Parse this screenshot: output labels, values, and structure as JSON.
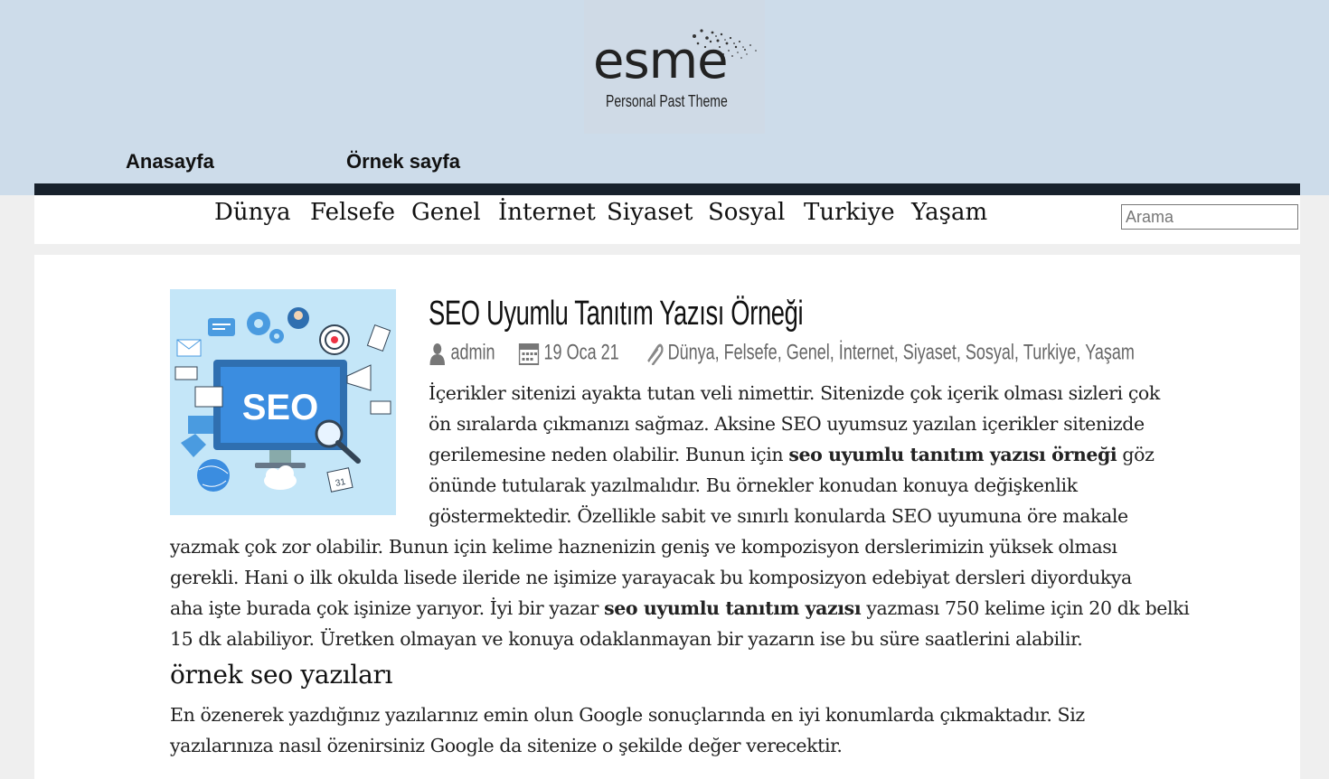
{
  "logo": {
    "name": "esme",
    "tagline": "Personal Past Theme"
  },
  "page_nav": [
    {
      "label": "Anasayfa"
    },
    {
      "label": "Örnek sayfa"
    }
  ],
  "categories": [
    "Dünya",
    "Felsefe",
    "Genel",
    "İnternet",
    "Siyaset",
    "Sosyal",
    "Turkiye",
    "Yaşam"
  ],
  "search": {
    "placeholder": "Arama"
  },
  "post": {
    "title": "SEO Uyumlu Tanıtım Yazısı Örneği",
    "thumbnail_label": "SEO",
    "meta": {
      "author": "admin",
      "date": "19 Oca 21",
      "categories": [
        "Dünya",
        "Felsefe",
        "Genel",
        "İnternet",
        "Siyaset",
        "Sosyal",
        "Turkiye",
        "Yaşam"
      ]
    },
    "intro_lines": [
      "İçerikler sitenizi ayakta tutan veli nimettir. Sitenizde çok içerik olması sizleri çok",
      "ön sıralarda çıkmanızı sağmaz. Aksine SEO uyumsuz yazılan içerikler sitenizde"
    ],
    "line3_before": "gerilemesine neden olabilir. Bunun için ",
    "line3_bold": "seo uyumlu tanıtım yazısı örneği",
    "line3_after": " göz",
    "line4": "önünde tutularak yazılmalıdır. Bu örnekler konudan konuya değişkenlik",
    "line5": "göstermektedir. Özellikle sabit ve sınırlı konularda SEO uyumuna öre makale",
    "line6": "yazmak çok zor olabilir. Bunun için kelime haznenizin geniş ve kompozisyon derslerimizin yüksek olması",
    "line7": "gerekli. Hani o ilk okulda lisede ileride ne işimize yarayacak bu komposizyon edebiyat dersleri diyordukya",
    "line8_before": "aha işte burada çok işinize yarıyor. İyi bir yazar ",
    "line8_bold": "seo uyumlu tanıtım yazısı",
    "line8_after": " yazması 750 kelime için 20 dk belki",
    "line9": "15 dk alabiliyor. Üretken olmayan ve konuya odaklanmayan bir yazarın ise bu süre  saatlerini alabilir.",
    "subheading": "örnek seo yazıları",
    "para2_lines": [
      "En özenerek yazdığınız yazılarınız emin olun Google sonuçlarında en iyi konumlarda çıkmaktadır. Siz",
      "yazılarınıza nasıl özenirsiniz Google da sitenize o şekilde değer verecektir."
    ]
  }
}
